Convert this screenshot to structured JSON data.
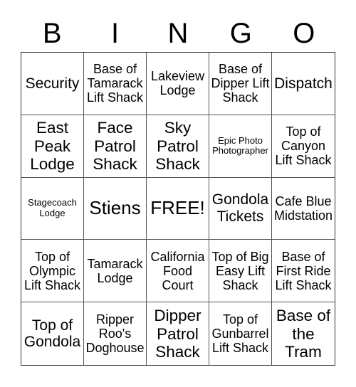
{
  "header": {
    "letters": [
      "B",
      "I",
      "N",
      "G",
      "O"
    ]
  },
  "cells": [
    [
      "Security",
      "Base of Tamarack Lift Shack",
      "Lakeview Lodge",
      "Base of Dipper Lift Shack",
      "Dispatch"
    ],
    [
      "East Peak Lodge",
      "Face Patrol Shack",
      "Sky Patrol Shack",
      "Epic Photo Photographer",
      "Top of Canyon Lift Shack"
    ],
    [
      "Stagecoach Lodge",
      "Stiens",
      "FREE!",
      "Gondola Tickets",
      "Cafe Blue Midstation"
    ],
    [
      "Top of Olympic Lift Shack",
      "Tamarack Lodge",
      "California Food Court",
      "Top of Big Easy Lift Shack",
      "Base of First Ride Lift Shack"
    ],
    [
      "Top of Gondola",
      "Ripper Roo's Doghouse",
      "Dipper Patrol Shack",
      "Top of Gunbarrel Lift Shack",
      "Base of the Tram"
    ]
  ]
}
